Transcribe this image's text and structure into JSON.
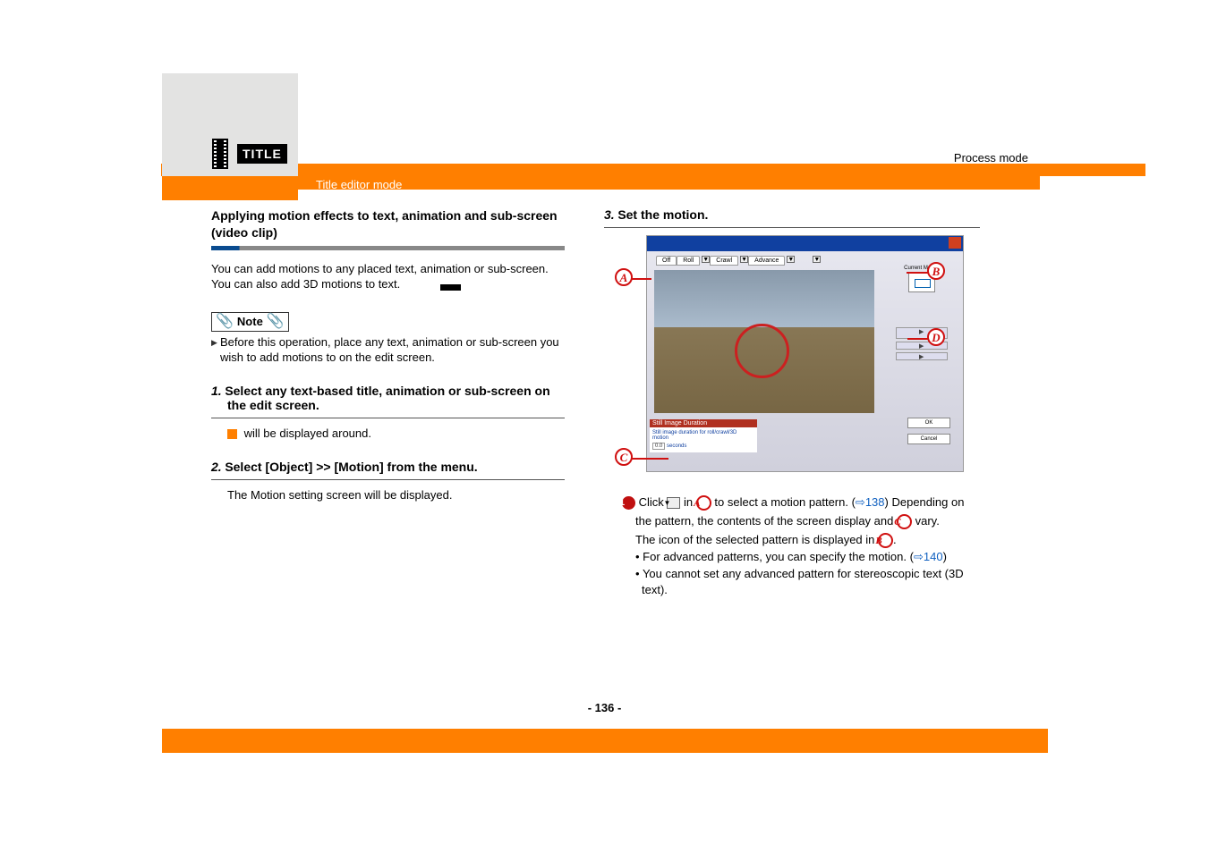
{
  "header": {
    "process_mode": "Process mode",
    "mode_label": "Title editor mode",
    "title_badge": "TITLE"
  },
  "left": {
    "section_title_1": "Applying motion effects to text, animation and sub-screen (video clip)",
    "intro_1": "You can add motions to any placed text, animation or sub-screen.",
    "intro_2": "You can also add 3D motions to text.",
    "note_label": "Note",
    "note_1": "Before this operation, place any text, animation or sub-screen you wish to add motions to on the edit screen.",
    "step1_num": "1.",
    "step1_title": "Select any text-based title, animation or sub-screen on the edit screen.",
    "step1_body": " will be displayed around.",
    "step2_num": "2.",
    "step2_title": "Select [Object] >> [Motion] from the menu.",
    "step2_body": "The Motion setting screen will be displayed."
  },
  "right": {
    "step3_num": "3.",
    "step3_title": "Set the motion.",
    "shot": {
      "tabs": {
        "off": "Off",
        "roll": "Roll",
        "crawl": "Crawl",
        "advance": "Advance"
      },
      "current_motion": "Current Motion",
      "ok": "OK",
      "cancel": "Cancel",
      "sid_title": "Still Image Duration",
      "sid_text": "Still image duration for roll/crawl/3D motion",
      "sid_val": "0.0",
      "sid_unit": "seconds"
    },
    "callouts": {
      "A": "A",
      "B": "B",
      "C": "C",
      "D": "D"
    },
    "sub_num": "1",
    "sub_pre": "Click ",
    "sub_mid_1": " in ",
    "sub_mid_2": " to select a motion pattern. (",
    "link_138": "138",
    "sub_mid_3": ") Depending on the pattern, the contents of the screen display and ",
    "sub_mid_4": " vary.",
    "sub_line2_a": "The icon of the selected pattern is displayed in ",
    "sub_line2_b": ".",
    "bullet1_a": "For advanced patterns, you can specify the motion. (",
    "link_140": "140",
    "bullet1_b": ")",
    "bullet2": "You cannot set any advanced pattern for stereoscopic text (3D text)."
  },
  "page_number": "- 136 -"
}
